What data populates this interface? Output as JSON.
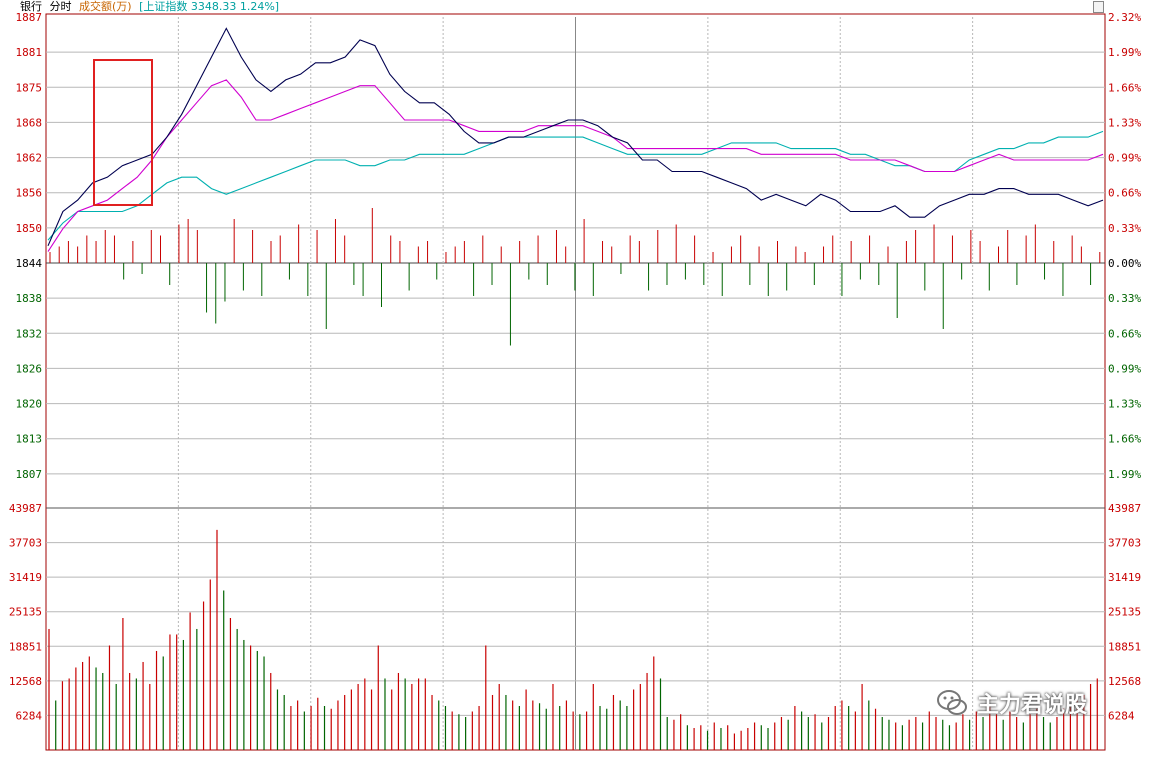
{
  "header": {
    "stock_name": "银行",
    "chart_mode": "分时",
    "volume_label": "成交额(万)",
    "index_label": "[上证指数 3348.33 1.24%]"
  },
  "colors": {
    "up": "#c80000",
    "down": "#006400",
    "price_line": "#000050",
    "avg_line": "#d000d0",
    "index_line": "#00b0b0",
    "grid": "#b8b8b8",
    "frame": "#a00000",
    "highlight_box": "#e02020"
  },
  "watermark": {
    "text": "主力君说股",
    "icon": "wechat-icon"
  },
  "chart_data": [
    {
      "type": "line",
      "title": "分时",
      "x_range": [
        0,
        240
      ],
      "y_range": [
        1807,
        1887
      ],
      "base_price": 1844,
      "left_ticks": [
        "1887",
        "1881",
        "1875",
        "1868",
        "1862",
        "1856",
        "1850",
        "1844",
        "1838",
        "1832",
        "1826",
        "1820",
        "1813",
        "1807"
      ],
      "right_ticks": [
        "2.32%",
        "1.99%",
        "1.66%",
        "1.33%",
        "0.99%",
        "0.66%",
        "0.33%",
        "0.00%",
        "0.33%",
        "0.66%",
        "0.99%",
        "1.33%",
        "1.66%",
        "1.99%"
      ],
      "series": [
        {
          "key": "price",
          "values": [
            1847,
            1853,
            1855,
            1858,
            1859,
            1861,
            1862,
            1863,
            1866,
            1870,
            1875,
            1880,
            1885,
            1880,
            1876,
            1874,
            1876,
            1877,
            1879,
            1879,
            1880,
            1883,
            1882,
            1877,
            1874,
            1872,
            1872,
            1870,
            1867,
            1865,
            1865,
            1866,
            1866,
            1867,
            1868,
            1869,
            1869,
            1868,
            1866,
            1865,
            1862,
            1862,
            1860,
            1860,
            1860,
            1859,
            1858,
            1857,
            1855,
            1856,
            1855,
            1854,
            1856,
            1855,
            1853,
            1853,
            1853,
            1854,
            1852,
            1852,
            1854,
            1855,
            1856,
            1856,
            1857,
            1857,
            1856,
            1856,
            1856,
            1855,
            1854,
            1855
          ],
          "x_step": 3.38
        },
        {
          "key": "avg",
          "values": [
            1846,
            1850,
            1853,
            1854,
            1855,
            1857,
            1859,
            1862,
            1866,
            1869,
            1872,
            1875,
            1876,
            1873,
            1869,
            1869,
            1870,
            1871,
            1872,
            1873,
            1874,
            1875,
            1875,
            1872,
            1869,
            1869,
            1869,
            1869,
            1868,
            1867,
            1867,
            1867,
            1867,
            1868,
            1868,
            1868,
            1868,
            1867,
            1866,
            1864,
            1864,
            1864,
            1864,
            1864,
            1864,
            1864,
            1864,
            1864,
            1863,
            1863,
            1863,
            1863,
            1863,
            1863,
            1862,
            1862,
            1862,
            1862,
            1861,
            1860,
            1860,
            1860,
            1861,
            1862,
            1863,
            1862,
            1862,
            1862,
            1862,
            1862,
            1862,
            1863
          ],
          "x_step": 3.38
        },
        {
          "key": "index",
          "values": [
            1848,
            1851,
            1853,
            1853,
            1853,
            1853,
            1854,
            1856,
            1858,
            1859,
            1859,
            1857,
            1856,
            1857,
            1858,
            1859,
            1860,
            1861,
            1862,
            1862,
            1862,
            1861,
            1861,
            1862,
            1862,
            1863,
            1863,
            1863,
            1863,
            1864,
            1865,
            1866,
            1866,
            1866,
            1866,
            1866,
            1866,
            1865,
            1864,
            1863,
            1863,
            1863,
            1863,
            1863,
            1863,
            1864,
            1865,
            1865,
            1865,
            1865,
            1864,
            1864,
            1864,
            1864,
            1863,
            1863,
            1862,
            1861,
            1861,
            1860,
            1860,
            1860,
            1862,
            1863,
            1864,
            1864,
            1865,
            1865,
            1866,
            1866,
            1866,
            1867
          ],
          "x_step": 3.38
        }
      ],
      "bars": [
        2,
        3,
        4,
        3,
        5,
        4,
        6,
        5,
        -3,
        4,
        -2,
        6,
        5,
        -4,
        7,
        8,
        6,
        -9,
        -11,
        -7,
        8,
        -5,
        6,
        -6,
        4,
        5,
        -3,
        7,
        -6,
        6,
        -12,
        8,
        5,
        -4,
        -6,
        10,
        -8,
        5,
        4,
        -5,
        3,
        4,
        -3,
        2,
        3,
        4,
        -6,
        5,
        -4,
        3,
        -15,
        4,
        -3,
        5,
        -4,
        6,
        3,
        -5,
        8,
        -6,
        4,
        3,
        -2,
        5,
        4,
        -5,
        6,
        -4,
        7,
        -3,
        5,
        -4,
        2,
        -6,
        3,
        5,
        -4,
        3,
        -6,
        4,
        -5,
        3,
        2,
        -4,
        3,
        5,
        -6,
        4,
        -3,
        5,
        -4,
        3,
        -10,
        4,
        6,
        -5,
        7,
        -12,
        5,
        -3,
        6,
        4,
        -5,
        3,
        6,
        -4,
        5,
        7,
        -3,
        4,
        -6,
        5,
        3,
        -4,
        2
      ],
      "highlight": {
        "x_start": 14,
        "x_end": 32,
        "y_top": 1880,
        "y_bottom": 1854
      }
    },
    {
      "type": "bar",
      "title": "成交额(万)",
      "y_range": [
        0,
        43987
      ],
      "left_ticks": [
        "43987",
        "37703",
        "31419",
        "25135",
        "18851",
        "12568",
        "6284"
      ],
      "right_ticks": [
        "43987",
        "37703",
        "31419",
        "25135",
        "18851",
        "12568",
        "6284"
      ],
      "values": [
        22000,
        9000,
        12500,
        13000,
        15000,
        16000,
        17000,
        15000,
        14000,
        19000,
        12000,
        24000,
        14000,
        13000,
        16000,
        12000,
        18000,
        17000,
        21000,
        21000,
        20000,
        25000,
        22000,
        27000,
        31000,
        40000,
        29000,
        24000,
        22000,
        20000,
        19000,
        18000,
        17000,
        14000,
        11000,
        10000,
        8000,
        9000,
        7000,
        8000,
        9500,
        8000,
        7500,
        9000,
        10000,
        11000,
        12000,
        13000,
        11000,
        19000,
        13000,
        11000,
        14000,
        13000,
        12000,
        13000,
        13000,
        10000,
        9000,
        8000,
        7000,
        6500,
        6000,
        7000,
        8000,
        19000,
        10000,
        12000,
        10000,
        9000,
        8000,
        11000,
        9000,
        8500,
        7500,
        12000,
        8000,
        9000,
        7000,
        6500,
        7000,
        12000,
        8000,
        7500,
        10000,
        9000,
        8000,
        11000,
        12000,
        14000,
        17000,
        13000,
        6000,
        5500,
        6500,
        4500,
        4000,
        4500,
        3500,
        5000,
        4000,
        4500,
        3000,
        3500,
        4000,
        5000,
        4500,
        4000,
        5000,
        6000,
        5500,
        8000,
        7000,
        6000,
        6500,
        5000,
        6000,
        8000,
        9000,
        8000,
        7000,
        12000,
        9000,
        7500,
        6000,
        5500,
        5000,
        4500,
        5500,
        6000,
        5000,
        7000,
        6000,
        5500,
        4500,
        5000,
        6500,
        5500,
        7000,
        6000,
        8000,
        6500,
        5500,
        7000,
        6000,
        5000,
        6500,
        7500,
        6000,
        5000,
        6000,
        7500,
        8000,
        9000,
        10000,
        12000,
        13000
      ]
    }
  ]
}
